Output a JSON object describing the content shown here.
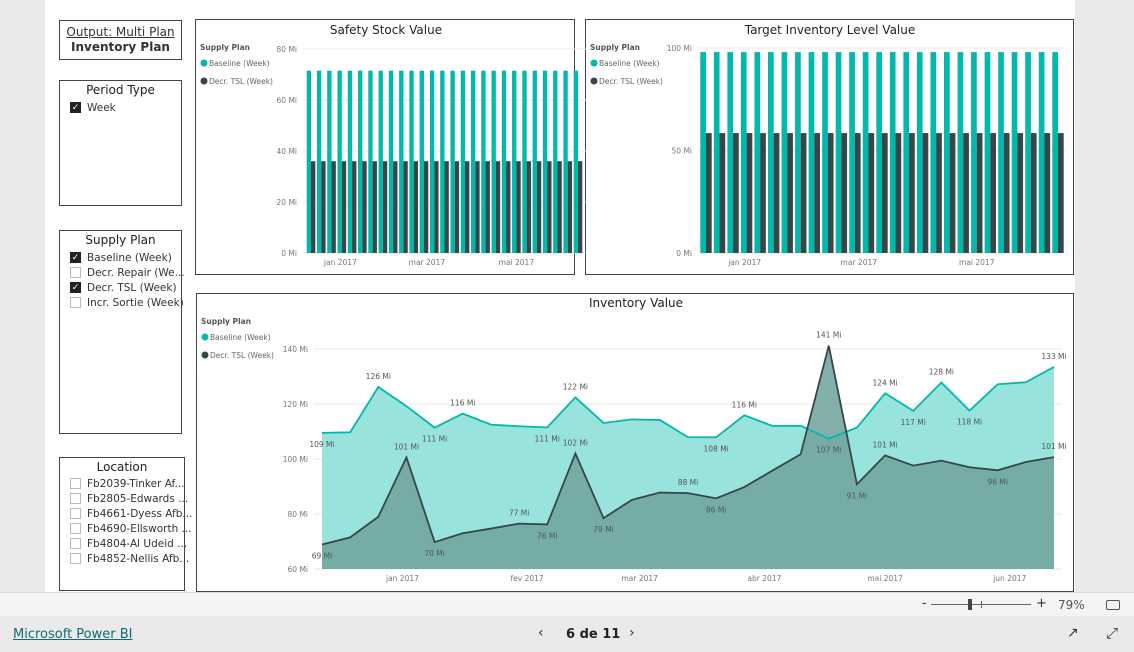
{
  "colors": {
    "baseline": "#01b8aa",
    "baseline_fill": "#99e3dd",
    "decr": "#374649",
    "decr_fill": "#6fa29c",
    "grid": "#e8e8e8"
  },
  "header": {
    "line1": "Output: Multi Plan",
    "line2": "Inventory Plan"
  },
  "period_type": {
    "title": "Period Type",
    "items": [
      {
        "label": "Week",
        "checked": true
      }
    ]
  },
  "supply_plan": {
    "title": "Supply Plan",
    "items": [
      {
        "label": "Baseline (Week)",
        "checked": true
      },
      {
        "label": "Decr. Repair (We...",
        "checked": false
      },
      {
        "label": "Decr. TSL (Week)",
        "checked": true
      },
      {
        "label": "Incr. Sortie (Week)",
        "checked": false
      }
    ]
  },
  "location": {
    "title": "Location",
    "items": [
      {
        "label": "Fb2039-Tinker Af...",
        "checked": false
      },
      {
        "label": "Fb2805-Edwards ...",
        "checked": false
      },
      {
        "label": "Fb4661-Dyess Afb...",
        "checked": false
      },
      {
        "label": "Fb4690-Ellsworth ...",
        "checked": false
      },
      {
        "label": "Fb4804-Al Udeid ...",
        "checked": false
      },
      {
        "label": "Fb4852-Nellis Afb...",
        "checked": false
      }
    ]
  },
  "chart_data": [
    {
      "type": "bar",
      "title": "Safety Stock  Value",
      "legend_title": "Supply Plan",
      "legend_position": "top-left",
      "x_start": "2016-12-12",
      "x_step_days": 7,
      "count": 27,
      "ylim": [
        0,
        80
      ],
      "yticks": [
        "0 Mi",
        "20 Mi",
        "40 Mi",
        "60 Mi",
        "80 Mi"
      ],
      "ytick_values": [
        0,
        20,
        40,
        60,
        80
      ],
      "xticks": [
        {
          "label": "jan 2017",
          "date": "2017-01-01"
        },
        {
          "label": "mar 2017",
          "date": "2017-03-01"
        },
        {
          "label": "mai 2017",
          "date": "2017-05-01"
        }
      ],
      "series": [
        {
          "name": "Baseline (Week)",
          "constant": 71.5
        },
        {
          "name": "Decr. TSL (Week)",
          "constant": 36
        }
      ]
    },
    {
      "type": "bar",
      "title": "Target Inventory Level Value",
      "legend_title": "Supply Plan",
      "legend_position": "top-left",
      "x_start": "2016-12-12",
      "x_step_days": 7,
      "count": 27,
      "ylim": [
        0,
        100
      ],
      "yticks": [
        "0 Mi",
        "50 Mi",
        "100 Mi"
      ],
      "ytick_values": [
        0,
        50,
        100
      ],
      "xticks": [
        {
          "label": "jan 2017",
          "date": "2017-01-01"
        },
        {
          "label": "mar 2017",
          "date": "2017-03-01"
        },
        {
          "label": "mai 2017",
          "date": "2017-05-01"
        }
      ],
      "series": [
        {
          "name": "Baseline (Week)",
          "constant": 98
        },
        {
          "name": "Decr. TSL (Week)",
          "constant": 58.5
        }
      ]
    },
    {
      "type": "area",
      "title": "Inventory Value",
      "legend_title": "Supply Plan",
      "legend_position": "top-left",
      "x_start": "2016-12-12",
      "x_step_days": 7,
      "ylim": [
        60,
        140
      ],
      "yticks": [
        "60 Mi",
        "80 Mi",
        "100 Mi",
        "120 Mi",
        "140 Mi"
      ],
      "ytick_values": [
        60,
        80,
        100,
        120,
        140
      ],
      "xticks": [
        {
          "label": "jan 2017",
          "date": "2017-01-01"
        },
        {
          "label": "fev 2017",
          "date": "2017-02-01"
        },
        {
          "label": "mar 2017",
          "date": "2017-03-01"
        },
        {
          "label": "abr 2017",
          "date": "2017-04-01"
        },
        {
          "label": "mai 2017",
          "date": "2017-05-01"
        },
        {
          "label": "jun 2017",
          "date": "2017-06-01"
        }
      ],
      "series": [
        {
          "name": "Baseline (Week)",
          "values": [
            109.5,
            109.7,
            126.2,
            119.2,
            111.4,
            116.5,
            112.5,
            111.9,
            111.5,
            122.4,
            113.1,
            114.4,
            114.2,
            107.9,
            107.9,
            115.9,
            112,
            112.1,
            107.4,
            111.4,
            123.9,
            117.5,
            127.8,
            117.6,
            127.2,
            127.9,
            133.5
          ],
          "labels": [
            {
              "i": 0,
              "text": "109 Mi",
              "pos": "below"
            },
            {
              "i": 2,
              "text": "126 Mi",
              "pos": "above"
            },
            {
              "i": 4,
              "text": "111 Mi",
              "pos": "below"
            },
            {
              "i": 5,
              "text": "116 Mi",
              "pos": "above"
            },
            {
              "i": 8,
              "text": "111 Mi",
              "pos": "below"
            },
            {
              "i": 9,
              "text": "122 Mi",
              "pos": "above"
            },
            {
              "i": 14,
              "text": "108 Mi",
              "pos": "below"
            },
            {
              "i": 15,
              "text": "116 Mi",
              "pos": "above"
            },
            {
              "i": 18,
              "text": "107 Mi",
              "pos": "below"
            },
            {
              "i": 20,
              "text": "124 Mi",
              "pos": "above"
            },
            {
              "i": 21,
              "text": "117 Mi",
              "pos": "below"
            },
            {
              "i": 22,
              "text": "128 Mi",
              "pos": "above"
            },
            {
              "i": 23,
              "text": "118 Mi",
              "pos": "below"
            },
            {
              "i": 26,
              "text": "133 Mi",
              "pos": "above"
            }
          ]
        },
        {
          "name": "Decr. TSL (Week)",
          "values": [
            68.9,
            71.5,
            79,
            100.6,
            69.8,
            73,
            74.7,
            76.5,
            76.2,
            102,
            78.5,
            85.1,
            87.8,
            87.6,
            85.7,
            89.8,
            95.8,
            101.7,
            141.2,
            90.8,
            101.3,
            97.6,
            99.4,
            97,
            95.9,
            98.9,
            100.7
          ],
          "labels": [
            {
              "i": 0,
              "text": "69 Mi",
              "pos": "below"
            },
            {
              "i": 3,
              "text": "101 Mi",
              "pos": "above"
            },
            {
              "i": 4,
              "text": "70 Mi",
              "pos": "below"
            },
            {
              "i": 7,
              "text": "77 Mi",
              "pos": "above"
            },
            {
              "i": 8,
              "text": "76 Mi",
              "pos": "below"
            },
            {
              "i": 9,
              "text": "102 Mi",
              "pos": "above"
            },
            {
              "i": 10,
              "text": "79 Mi",
              "pos": "below"
            },
            {
              "i": 13,
              "text": "88 Mi",
              "pos": "above"
            },
            {
              "i": 14,
              "text": "86 Mi",
              "pos": "below"
            },
            {
              "i": 18,
              "text": "141 Mi",
              "pos": "above"
            },
            {
              "i": 19,
              "text": "91 Mi",
              "pos": "below"
            },
            {
              "i": 20,
              "text": "101 Mi",
              "pos": "above"
            },
            {
              "i": 24,
              "text": "96 Mi",
              "pos": "below"
            },
            {
              "i": 26,
              "text": "101 Mi",
              "pos": "above"
            }
          ]
        }
      ]
    }
  ],
  "zoom": {
    "minus": "-",
    "plus": "+",
    "level_percent": 79,
    "level_label": "79%"
  },
  "footer": {
    "brand": "Microsoft Power BI",
    "page": "6 de 11",
    "icons": [
      "fit-page-icon",
      "share-icon",
      "fullscreen-icon",
      "chevron-left-icon",
      "chevron-right-icon"
    ]
  }
}
